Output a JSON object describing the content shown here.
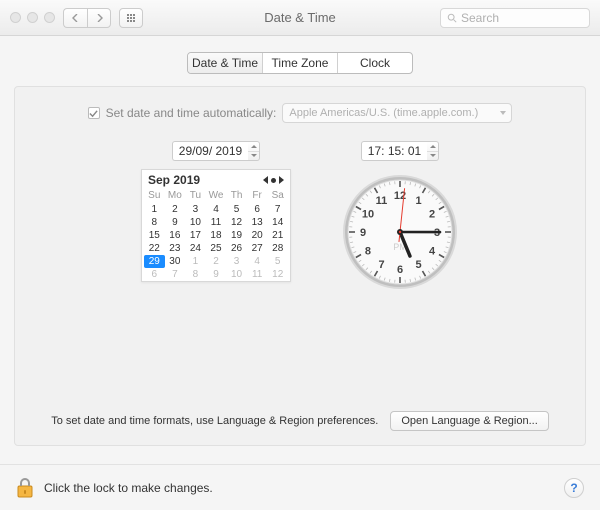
{
  "window": {
    "title": "Date & Time",
    "search_placeholder": "Search"
  },
  "tabs": {
    "items": [
      "Date & Time",
      "Time Zone",
      "Clock"
    ],
    "active_index": 0
  },
  "auto": {
    "label": "Set date and time automatically:",
    "checked": true,
    "server": "Apple Americas/U.S. (time.apple.com.)"
  },
  "date": {
    "value": "29/09/ 2019",
    "month_label": "Sep 2019",
    "dow": [
      "Su",
      "Mo",
      "Tu",
      "We",
      "Th",
      "Fr",
      "Sa"
    ],
    "rows": [
      [
        {
          "n": 1
        },
        {
          "n": 2
        },
        {
          "n": 3
        },
        {
          "n": 4
        },
        {
          "n": 5
        },
        {
          "n": 6
        },
        {
          "n": 7
        }
      ],
      [
        {
          "n": 8
        },
        {
          "n": 9
        },
        {
          "n": 10
        },
        {
          "n": 11
        },
        {
          "n": 12
        },
        {
          "n": 13
        },
        {
          "n": 14
        }
      ],
      [
        {
          "n": 15
        },
        {
          "n": 16
        },
        {
          "n": 17
        },
        {
          "n": 18
        },
        {
          "n": 19
        },
        {
          "n": 20
        },
        {
          "n": 21
        }
      ],
      [
        {
          "n": 22
        },
        {
          "n": 23
        },
        {
          "n": 24
        },
        {
          "n": 25
        },
        {
          "n": 26
        },
        {
          "n": 27
        },
        {
          "n": 28
        }
      ],
      [
        {
          "n": 29,
          "sel": true
        },
        {
          "n": 30
        },
        {
          "n": 1,
          "other": true
        },
        {
          "n": 2,
          "other": true
        },
        {
          "n": 3,
          "other": true
        },
        {
          "n": 4,
          "other": true
        },
        {
          "n": 5,
          "other": true
        }
      ],
      [
        {
          "n": 6,
          "other": true
        },
        {
          "n": 7,
          "other": true
        },
        {
          "n": 8,
          "other": true
        },
        {
          "n": 9,
          "other": true
        },
        {
          "n": 10,
          "other": true
        },
        {
          "n": 11,
          "other": true
        },
        {
          "n": 12,
          "other": true
        }
      ]
    ]
  },
  "time": {
    "value": "17: 15: 01",
    "hour": 17,
    "minute": 15,
    "second": 1,
    "ampm": "PM"
  },
  "formats": {
    "hint": "To set date and time formats, use Language & Region preferences.",
    "button": "Open Language & Region..."
  },
  "footer": {
    "lock_text": "Click the lock to make changes.",
    "help": "?"
  },
  "clock_face": {
    "numerals": {
      "12": "12",
      "1": "1",
      "2": "2",
      "3": "3",
      "4": "4",
      "5": "5",
      "6": "6",
      "7": "7",
      "8": "8",
      "9": "9",
      "10": "10",
      "11": "11"
    }
  }
}
